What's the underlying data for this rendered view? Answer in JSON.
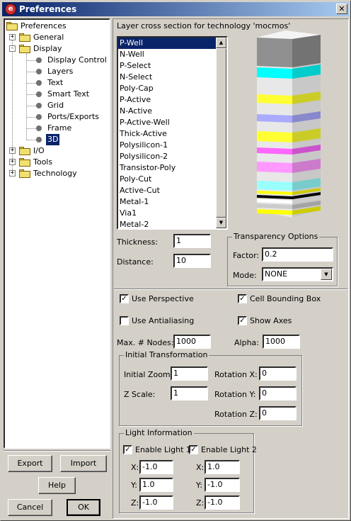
{
  "window": {
    "title": "Preferences",
    "close_glyph": "✕"
  },
  "tree": [
    {
      "label": "Preferences",
      "kind": "folder"
    },
    {
      "label": "General",
      "kind": "folder",
      "pm": "+"
    },
    {
      "label": "Display",
      "kind": "folder",
      "pm": "-"
    },
    {
      "label": "Display Control",
      "kind": "leaf"
    },
    {
      "label": "Layers",
      "kind": "leaf"
    },
    {
      "label": "Text",
      "kind": "leaf"
    },
    {
      "label": "Smart Text",
      "kind": "leaf"
    },
    {
      "label": "Grid",
      "kind": "leaf"
    },
    {
      "label": "Ports/Exports",
      "kind": "leaf"
    },
    {
      "label": "Frame",
      "kind": "leaf"
    },
    {
      "label": "3D",
      "kind": "leaf",
      "selected": true
    },
    {
      "label": "I/O",
      "kind": "folder",
      "pm": "+"
    },
    {
      "label": "Tools",
      "kind": "folder",
      "pm": "+"
    },
    {
      "label": "Technology",
      "kind": "folder",
      "pm": "+"
    }
  ],
  "buttons": {
    "export": "Export",
    "import": "Import",
    "help": "Help",
    "cancel": "Cancel",
    "ok": "OK"
  },
  "panel": {
    "header": "Layer cross section for technology 'mocmos'",
    "layers": [
      "P-Well",
      "N-Well",
      "P-Select",
      "N-Select",
      "Poly-Cap",
      "P-Active",
      "N-Active",
      "P-Active-Well",
      "Thick-Active",
      "Polysilicon-1",
      "Polysilicon-2",
      "Transistor-Poly",
      "Poly-Cut",
      "Active-Cut",
      "Metal-1",
      "Via1",
      "Metal-2"
    ],
    "selected_layer": "P-Well",
    "thickness_label": "Thickness:",
    "thickness": "1",
    "distance_label": "Distance:",
    "distance": "10",
    "transparency": {
      "title": "Transparency Options",
      "factor_label": "Factor:",
      "factor": "0.2",
      "mode_label": "Mode:",
      "mode": "NONE"
    },
    "use_perspective": "Use Perspective",
    "cell_bounding_box": "Cell  Bounding Box",
    "use_antialiasing": "Use Antialiasing",
    "show_axes": "Show Axes",
    "max_nodes_label": "Max. # Nodes:",
    "max_nodes": "1000",
    "alpha_label": "Alpha:",
    "alpha": "1000",
    "initial_transformation": {
      "title": "Initial Transformation",
      "zoom_label": "Initial Zoom:",
      "zoom": "1",
      "zscale_label": "Z Scale:",
      "zscale": "1",
      "rotx_label": "Rotation X:",
      "rotx": "0",
      "roty_label": "Rotation Y:",
      "roty": "0",
      "rotz_label": "Rotation Z:",
      "rotz": "0"
    },
    "light": {
      "title": "Light Information",
      "light1": "Enable Light 1",
      "light2": "Enable Light 2",
      "x_label": "X:",
      "y_label": "Y:",
      "z_label": "Z:",
      "l1x": "-1.0",
      "l1y": "1.0",
      "l1z": "-1.0",
      "l2x": "1.0",
      "l2y": "-1.0",
      "l2z": "-1.0"
    }
  },
  "check_glyph": "✓",
  "stack_colors": [
    "#909090",
    "#00ffff",
    "#ffff33",
    "#aaaaff",
    "#ffff33",
    "#ff66ff",
    "#ff99ff",
    "#99ffff",
    "#ffff00",
    "#000000",
    "#ffffff",
    "#cccccc",
    "#cccc33"
  ]
}
